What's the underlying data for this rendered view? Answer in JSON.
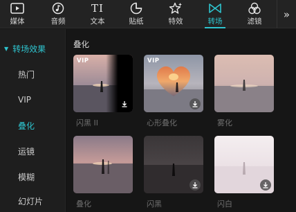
{
  "toolbar": {
    "tools": [
      {
        "label": "媒体",
        "icon": "media-icon"
      },
      {
        "label": "音频",
        "icon": "music-note-icon"
      },
      {
        "label": "文本",
        "icon": "text-icon",
        "glyph": "TI"
      },
      {
        "label": "贴纸",
        "icon": "sticker-icon"
      },
      {
        "label": "特效",
        "icon": "sparkle-star-icon"
      },
      {
        "label": "转场",
        "icon": "transition-bowtie-icon",
        "active": true
      },
      {
        "label": "滤镜",
        "icon": "filter-circles-icon"
      }
    ],
    "more_glyph": "»",
    "accent": "#2ec4cf"
  },
  "sidebar": {
    "header": {
      "caret": "▼",
      "label": "转场效果"
    },
    "items": [
      {
        "label": "热门"
      },
      {
        "label": "VIP"
      },
      {
        "label": "叠化",
        "active": true
      },
      {
        "label": "运镜"
      },
      {
        "label": "模糊"
      },
      {
        "label": "幻灯片"
      }
    ]
  },
  "main": {
    "section_title": "叠化",
    "cards": [
      {
        "label": "闪黑 II",
        "badge": "VIP",
        "download": "plain"
      },
      {
        "label": "心形叠化",
        "badge": "VIP",
        "download": "circle"
      },
      {
        "label": "雾化",
        "badge": "",
        "download": ""
      },
      {
        "label": "叠化",
        "badge": "",
        "download": ""
      },
      {
        "label": "闪黑",
        "badge": "",
        "download": "circle"
      },
      {
        "label": "闪白",
        "badge": "",
        "download": "circle"
      }
    ]
  }
}
